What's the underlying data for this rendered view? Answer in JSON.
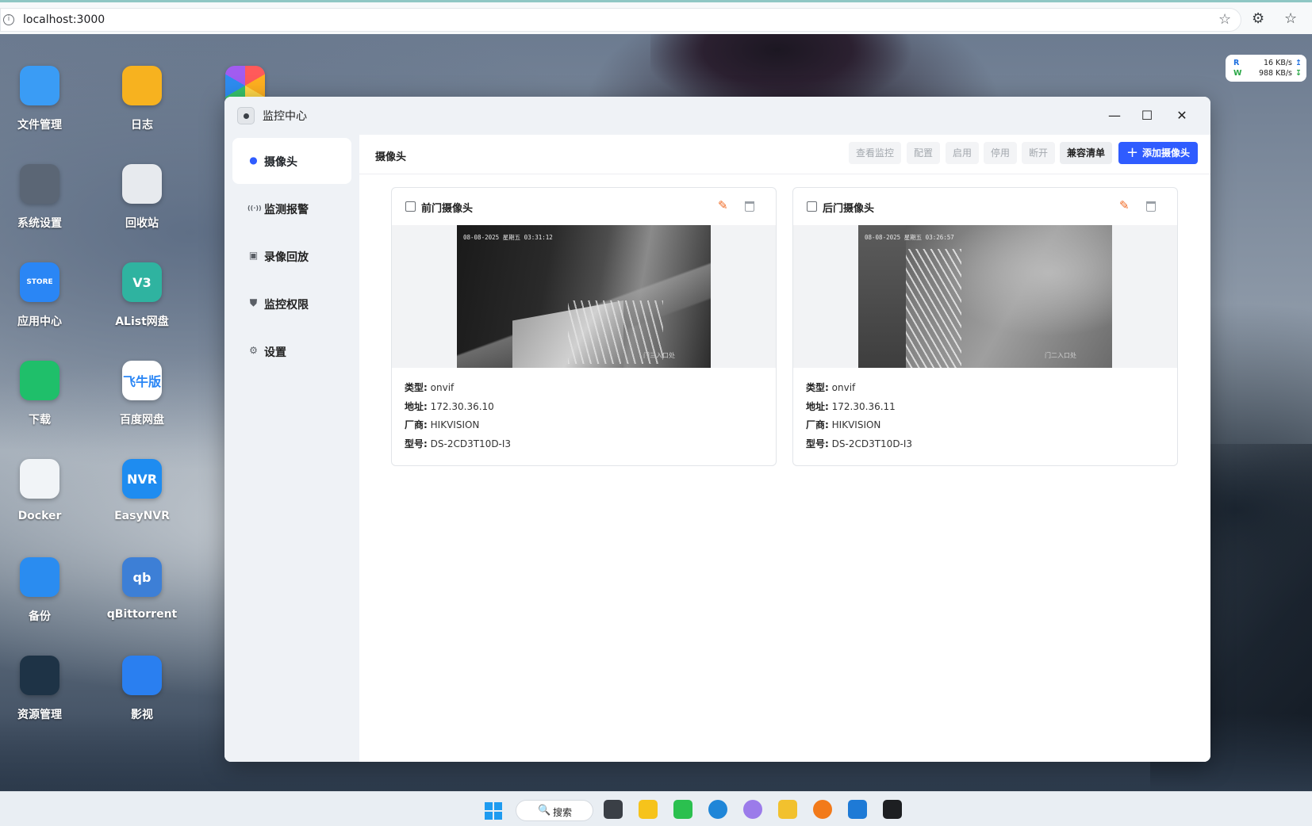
{
  "browser": {
    "url": "localhost:3000",
    "site_info_icon": "i"
  },
  "net_speed": {
    "read_key": "R",
    "read_value": "16 KB/s",
    "write_key": "W",
    "write_value": "988 KB/s"
  },
  "desktop_icons": [
    {
      "label": "文件管理",
      "icon": "folder-icon",
      "color": "#3a9cf5"
    },
    {
      "label": "日志",
      "icon": "log-icon",
      "color": "#f7b21f"
    },
    {
      "label": "系统设置",
      "icon": "gear-icon",
      "color": "#5b6675"
    },
    {
      "label": "回收站",
      "icon": "recycle-icon",
      "color": "#e7eaee"
    },
    {
      "label": "应用中心",
      "icon": "store-icon",
      "color": "#2a86f5",
      "text": "STORE"
    },
    {
      "label": "AList网盘",
      "icon": "alist-icon",
      "color": "#2fb3a0",
      "text": "V3"
    },
    {
      "label": "下载",
      "icon": "download-icon",
      "color": "#1fbf6a"
    },
    {
      "label": "百度网盘",
      "icon": "baidu-icon",
      "color": "#ffffff",
      "text": "飞牛版"
    },
    {
      "label": "Docker",
      "icon": "docker-icon",
      "color": "#f1f4f7"
    },
    {
      "label": "EasyNVR",
      "icon": "nvr-icon",
      "color": "#1e8cf0",
      "text": "NVR"
    },
    {
      "label": "备份",
      "icon": "backup-icon",
      "color": "#2a8cf0"
    },
    {
      "label": "qBittorrent",
      "icon": "qb-icon",
      "color": "#3d7fd6",
      "text": "qb"
    },
    {
      "label": "资源管理",
      "icon": "monitor-icon",
      "color": "#1e3346"
    },
    {
      "label": "影视",
      "icon": "video-icon",
      "color": "#2a7ff0"
    }
  ],
  "window": {
    "title": "监控中心",
    "minimize": "—",
    "maximize": "☐",
    "close": "✕"
  },
  "sidebar": {
    "items": [
      {
        "label": "摄像头",
        "icon": "camera-icon",
        "glyph": "●",
        "active": true
      },
      {
        "label": "监测报警",
        "icon": "alarm-icon",
        "glyph": "((·))",
        "active": false
      },
      {
        "label": "录像回放",
        "icon": "playback-icon",
        "glyph": "▣",
        "active": false
      },
      {
        "label": "监控权限",
        "icon": "shield-icon",
        "glyph": "⛊",
        "active": false
      },
      {
        "label": "设置",
        "icon": "settings-icon",
        "glyph": "⚙",
        "active": false
      }
    ]
  },
  "main": {
    "section_title": "摄像头",
    "toolbar": {
      "view": "查看监控",
      "config": "配置",
      "enable": "启用",
      "disable": "停用",
      "disconnect": "断开",
      "compat_list": "兼容清单",
      "add_camera": "添加摄像头",
      "add_plus": "+"
    }
  },
  "cameras": [
    {
      "name": "前门摄像头",
      "osd_time": "08-08-2025 星期五 03:31:12",
      "osd_location": "门三入口处",
      "type_label": "类型:",
      "type": "onvif",
      "address_label": "地址:",
      "address": "172.30.36.10",
      "vendor_label": "厂商:",
      "vendor": "HIKVISION",
      "model_label": "型号:",
      "model": "DS-2CD3T10D-I3"
    },
    {
      "name": "后门摄像头",
      "osd_time": "08-08-2025 星期五 03:26:57",
      "osd_location": "门二入口处",
      "type_label": "类型:",
      "type": "onvif",
      "address_label": "地址:",
      "address": "172.30.36.11",
      "vendor_label": "厂商:",
      "vendor": "HIKVISION",
      "model_label": "型号:",
      "model": "DS-2CD3T10D-I3"
    }
  ],
  "taskbar": {
    "search_label": "搜索",
    "search_glyph": "🔍",
    "apps": [
      {
        "icon": "task-view-icon",
        "color": "#3a3f46"
      },
      {
        "icon": "music-icon",
        "color": "#f6c31b"
      },
      {
        "icon": "wechat-icon",
        "color": "#2bc04f"
      },
      {
        "icon": "edge-icon",
        "color": "#1f86d8"
      },
      {
        "icon": "cat-app-icon",
        "color": "#9b7bea"
      },
      {
        "icon": "file-explorer-icon",
        "color": "#f2c12e"
      },
      {
        "icon": "orange-app-icon",
        "color": "#f27a1a"
      },
      {
        "icon": "vscode-icon",
        "color": "#1e7ad6"
      },
      {
        "icon": "terminal-icon",
        "color": "#1d1f22"
      }
    ]
  }
}
